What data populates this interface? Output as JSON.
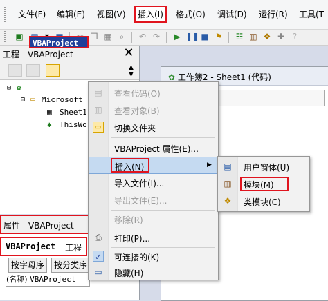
{
  "menubar": {
    "items": [
      "文件(F)",
      "编辑(E)",
      "视图(V)",
      "插入(I)",
      "格式(O)",
      "调试(D)",
      "运行(R)",
      "工具(T"
    ]
  },
  "project_explorer": {
    "title": "工程 - VBAProject",
    "close_icon": "close-icon",
    "tree": {
      "root": "VBAProject",
      "folder": "Microsoft",
      "sheet": "Sheet1",
      "workbook": "ThisWo"
    }
  },
  "properties": {
    "title": "属性 - VBAProject",
    "object_name": "VBAProject",
    "object_type": "工程",
    "tabs": [
      "按字母序",
      "按分类序"
    ],
    "row_name": "(名称)",
    "row_value": "VBAProject"
  },
  "code_window": {
    "title": "工作簿2 - Sheet1 (代码)"
  },
  "context_menu": {
    "items": [
      {
        "label": "查看代码(O)",
        "disabled": true,
        "icon": "code-icon"
      },
      {
        "label": "查看对象(B)",
        "disabled": true,
        "icon": "object-icon"
      },
      {
        "label": "切换文件夹",
        "disabled": false,
        "icon": "folder-icon"
      },
      {
        "label": "VBAProject 属性(E)...",
        "disabled": false,
        "icon": ""
      },
      {
        "label": "插入(N)",
        "disabled": false,
        "icon": "",
        "submenu_arrow": "▶"
      },
      {
        "label": "导入文件(I)...",
        "disabled": false,
        "icon": ""
      },
      {
        "label": "导出文件(E)...",
        "disabled": true,
        "icon": ""
      },
      {
        "label": "移除(R)",
        "disabled": true,
        "icon": ""
      },
      {
        "label": "打印(P)...",
        "disabled": false,
        "icon": "print-icon"
      },
      {
        "label": "可连接的(K)",
        "disabled": false,
        "icon": "check-icon"
      },
      {
        "label": "隐藏(H)",
        "disabled": false,
        "icon": "hide-icon"
      }
    ]
  },
  "insert_submenu": {
    "items": [
      {
        "label": "用户窗体(U)",
        "icon": "userform-icon"
      },
      {
        "label": "模块(M)",
        "icon": "module-icon"
      },
      {
        "label": "类模块(C)",
        "icon": "class-module-icon"
      }
    ]
  },
  "colors": {
    "highlight_red": "#e0141e",
    "selection_blue": "#1f3f9a",
    "menu_hover": "#c5daf1"
  }
}
